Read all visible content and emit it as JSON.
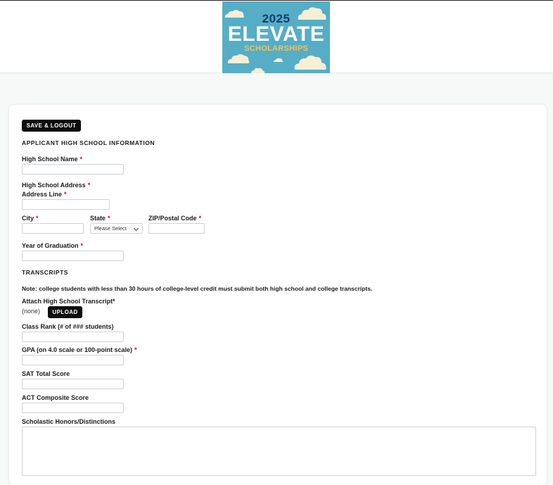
{
  "logo": {
    "year": "2025",
    "main": "ELEVATE",
    "sub": "SCHOLARSHIPS"
  },
  "toolbar": {
    "save_logout_label": "SAVE & LOGOUT"
  },
  "section_high_school": {
    "heading": "APPLICANT HIGH SCHOOL INFORMATION",
    "high_school_name_label": "High School Name",
    "high_school_address_label": "High School Address",
    "address_line_label": "Address Line",
    "city_label": "City",
    "state_label": "State",
    "state_selected": "Please Select",
    "zip_label": "ZIP/Postal Code",
    "year_graduation_label": "Year of Graduation"
  },
  "section_transcripts": {
    "heading": "TRANSCRIPTS",
    "note": "Note: college students with less than 30 hours of college-level credit must submit both high school and college transcripts.",
    "attach_label": "Attach High School Transcript*",
    "attach_value": "(none)",
    "upload_label": "UPLOAD",
    "class_rank_label": "Class Rank (# of ### students)",
    "gpa_label": "GPA (on 4.0 scale or 100-point scale)",
    "sat_label": "SAT Total Score",
    "act_label": "ACT Composite Score",
    "honors_label": "Scholastic Honors/Distinctions"
  },
  "required_marker": "*",
  "colors": {
    "logo_background": "#55aec6",
    "logo_year": "#123a6b",
    "logo_sub": "#f2c25a",
    "button": "#0c0c0c",
    "required": "#d0021b"
  }
}
